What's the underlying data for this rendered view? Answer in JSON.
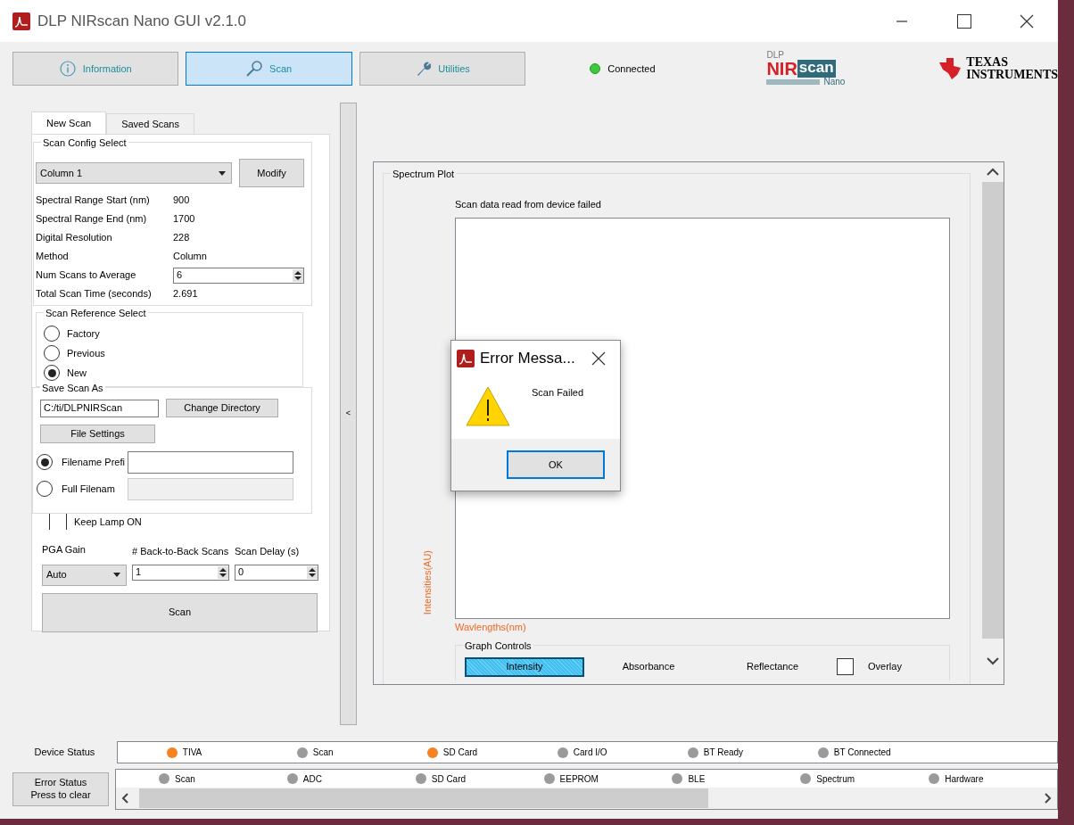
{
  "window": {
    "title": "DLP NIRscan Nano GUI v2.1.0"
  },
  "top_tabs": [
    {
      "label": "Information",
      "selected": false
    },
    {
      "label": "Scan",
      "selected": true
    },
    {
      "label": "Utilities",
      "selected": false
    }
  ],
  "connection": {
    "label": "Connected",
    "connected": true
  },
  "nirscan_logo": {
    "top": "DLP",
    "nir": "NIR",
    "scan": "scan",
    "bottom": "Nano"
  },
  "ti_logo": {
    "line_1": "TEXAS",
    "line_2": "INSTRUMENTS"
  },
  "scan_panel": {
    "tabs": [
      {
        "label": "New Scan",
        "selected": true
      },
      {
        "label": "Saved Scans",
        "selected": false
      }
    ],
    "config": {
      "legend": "Scan Config Select",
      "dropdown": "Column 1",
      "button": "Modify"
    },
    "properties": [
      {
        "kind": "text",
        "label": "Spectral Range Start (nm)",
        "value": "900"
      },
      {
        "kind": "text",
        "label": "Spectral Range End (nm)",
        "value": "1700"
      },
      {
        "kind": "text",
        "label": "Digital Resolution",
        "value": "228"
      },
      {
        "kind": "text",
        "label": "Method",
        "value": "Column"
      },
      {
        "kind": "spinner",
        "label": "Num Scans to Average",
        "value": "6"
      },
      {
        "kind": "text",
        "label": "Total Scan Time (seconds)",
        "value": "2.691"
      }
    ],
    "reference": {
      "legend": "Scan Reference Select",
      "options": [
        {
          "label": "Factory",
          "selected": false
        },
        {
          "label": "Previous",
          "selected": false
        },
        {
          "label": "New",
          "selected": true
        }
      ]
    },
    "save": {
      "legend": "Save Scan As",
      "directory": "C:/ti/DLPNIRScan",
      "change_button": "Change Directory",
      "settings_button": "File Settings",
      "name_options": [
        {
          "label": "Filename Prefi",
          "selected": true,
          "disabled": false
        },
        {
          "label": "Full Filenam",
          "selected": false,
          "disabled": true
        }
      ]
    },
    "keep_lamp": {
      "label": "Keep Lamp ON",
      "checked": false
    },
    "pga_gain": {
      "label": "PGA Gain",
      "value": "Auto"
    },
    "back_to_back": {
      "label": "# Back-to-Back Scans",
      "value": "1"
    },
    "scan_delay": {
      "label": "Scan Delay (s)",
      "value": "0"
    },
    "scan_button": "Scan"
  },
  "collapse_button": "<",
  "spectrum": {
    "legend": "Spectrum Plot",
    "message": "Scan data read from device failed",
    "ylabel": "Intensities(AU)",
    "xlabel": "Wavlengths(nm)",
    "graph_controls": {
      "legend": "Graph Controls",
      "modes": [
        {
          "label": "Intensity",
          "selected": true
        },
        {
          "label": "Absorbance",
          "selected": false
        },
        {
          "label": "Reflectance",
          "selected": false
        }
      ],
      "overlay": {
        "label": "Overlay",
        "checked": false
      }
    }
  },
  "device_status": {
    "label": "Device Status",
    "indicators": [
      {
        "label": "TIVA",
        "color": "#f5821f"
      },
      {
        "label": "Scan",
        "color": "#9a9a9a"
      },
      {
        "label": "SD Card",
        "color": "#f5821f"
      },
      {
        "label": "Card I/O",
        "color": "#9a9a9a"
      },
      {
        "label": "BT Ready",
        "color": "#9a9a9a"
      },
      {
        "label": "BT Connected",
        "color": "#9a9a9a"
      }
    ]
  },
  "error_status": {
    "button_lines": [
      "Error Status",
      "Press to clear"
    ],
    "indicators": [
      {
        "label": "Scan",
        "color": "#9a9a9a"
      },
      {
        "label": "ADC",
        "color": "#9a9a9a"
      },
      {
        "label": "SD Card",
        "color": "#9a9a9a"
      },
      {
        "label": "EEPROM",
        "color": "#9a9a9a"
      },
      {
        "label": "BLE",
        "color": "#9a9a9a"
      },
      {
        "label": "Spectrum",
        "color": "#9a9a9a"
      },
      {
        "label": "Hardware",
        "color": "#9a9a9a"
      }
    ]
  },
  "dialog": {
    "title": "Error Messa...",
    "message": "Scan Failed",
    "button": "OK"
  }
}
